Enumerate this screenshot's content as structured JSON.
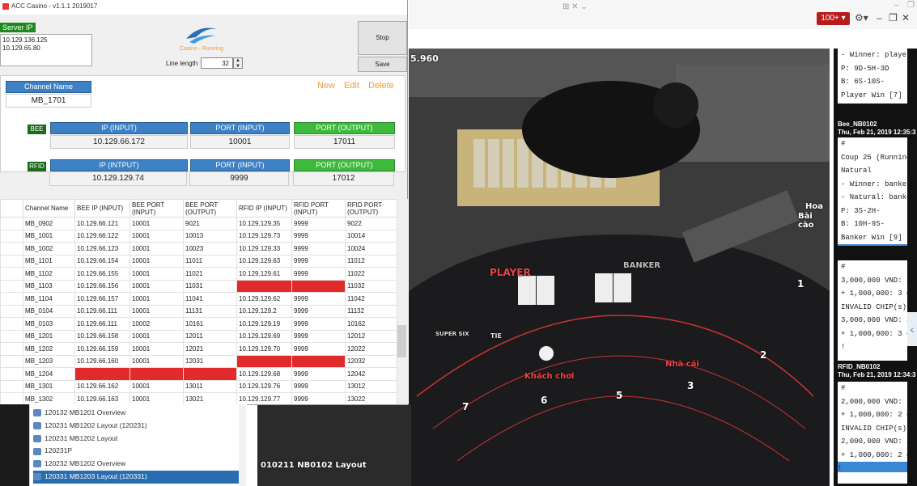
{
  "app": {
    "title": "ACC Casino - v1.1.1 2019017",
    "server_label": "Server IP",
    "server_ips": [
      "10.129.136.125",
      "10.129.65.80"
    ],
    "status": "Casino - Running",
    "line_length_label": "Line length",
    "line_length_value": "32",
    "stop_label": "Stop",
    "save_label": "Save",
    "channel_name_header": "Channel Name",
    "channel_name_value": "MB_1701",
    "new_label": "New",
    "edit_label": "Edit",
    "delete_label": "Delete",
    "bee_tag": "BEE",
    "rfid_tag": "RFID",
    "bee_headers": [
      "IP (INPUT)",
      "PORT (INPUT)",
      "PORT (OUTPUT)"
    ],
    "bee_values": [
      "10.129.66.172",
      "10001",
      "17011"
    ],
    "rfid_headers": [
      "IP (INTPUT)",
      "PORT (INPUT)",
      "PORT (OUTPUT)"
    ],
    "rfid_values": [
      "10.129.129.74",
      "9999",
      "17012"
    ]
  },
  "grid": {
    "columns": [
      "Channel Name",
      "BEE IP (INPUT)",
      "BEE PORT (INPUT)",
      "BEE PORT (OUTPUT)",
      "RFID IP (INPUT)",
      "RFID PORT (INPUT)",
      "RFID PORT (OUTPUT)"
    ],
    "rows": [
      {
        "cells": [
          "MB_0902",
          "10.129.66.121",
          "10001",
          "9021",
          "10.129.129.35",
          "9999",
          "9022"
        ],
        "red": []
      },
      {
        "cells": [
          "MB_1001",
          "10.129.66.122",
          "10001",
          "10013",
          "10.129.129.73",
          "9999",
          "10014"
        ],
        "red": []
      },
      {
        "cells": [
          "MB_1002",
          "10.129.66.123",
          "10001",
          "10023",
          "10.129.129.33",
          "9999",
          "10024"
        ],
        "red": []
      },
      {
        "cells": [
          "MB_1101",
          "10.129.66.154",
          "10001",
          "11011",
          "10.129.129.63",
          "9999",
          "11012"
        ],
        "red": []
      },
      {
        "cells": [
          "MB_1102",
          "10.129.66.155",
          "10001",
          "11021",
          "10.129.129.61",
          "9999",
          "11022"
        ],
        "red": []
      },
      {
        "cells": [
          "MB_1103",
          "10.129.66.156",
          "10001",
          "11031",
          "",
          "",
          "11032"
        ],
        "red": [
          4,
          5
        ]
      },
      {
        "cells": [
          "MB_1104",
          "10.129.66.157",
          "10001",
          "11041",
          "10.129.129.62",
          "9999",
          "11042"
        ],
        "red": []
      },
      {
        "cells": [
          "MB_0104",
          "10.129.66.111",
          "10001",
          "11131",
          "10.129.129.2",
          "9999",
          "11132"
        ],
        "red": []
      },
      {
        "cells": [
          "MB_0103",
          "10.129.66.111",
          "10002",
          "10161",
          "10.129.129.19",
          "9999",
          "10162"
        ],
        "red": []
      },
      {
        "cells": [
          "MB_1201",
          "10.129.66.158",
          "10001",
          "12011",
          "10.129.129.69",
          "9999",
          "12012"
        ],
        "red": []
      },
      {
        "cells": [
          "MB_1202",
          "10.129.66.159",
          "10001",
          "12021",
          "10.129.129.70",
          "9999",
          "12022"
        ],
        "red": []
      },
      {
        "cells": [
          "MB_1203",
          "10.129.66.160",
          "10001",
          "12031",
          "",
          "",
          "12032"
        ],
        "red": [
          4,
          5
        ]
      },
      {
        "cells": [
          "MB_1204",
          "",
          "",
          "",
          "10.129.129.68",
          "9999",
          "12042"
        ],
        "red": [
          1,
          2,
          3
        ]
      },
      {
        "cells": [
          "MB_1301",
          "10.129.66.162",
          "10001",
          "13011",
          "10.129.129.76",
          "9999",
          "13012"
        ],
        "red": []
      },
      {
        "cells": [
          "MB_1302",
          "10.129.66.163",
          "10001",
          "13021",
          "10.129.129.77",
          "9999",
          "13022"
        ],
        "red": []
      }
    ]
  },
  "tree": {
    "items": [
      {
        "label": "120132 MB1201 Overview",
        "selected": false
      },
      {
        "label": "120231 MB1202 Layout (120231)",
        "selected": false
      },
      {
        "label": "120231 MB1202 Layout",
        "selected": false
      },
      {
        "label": "120231P",
        "selected": false
      },
      {
        "label": "120232 MB1202 Overview",
        "selected": false
      },
      {
        "label": "120331 MB1203 Layout (120331)",
        "selected": true
      }
    ]
  },
  "viewer": {
    "alert_badge": "100+ ▾",
    "timestamp_fragment": "5.960",
    "camera_label": "010211 NB0102 Layout",
    "table_words": [
      "PLAYER",
      "BANKER",
      "Khách chơi",
      "Nhà cái",
      "TIE",
      "SUPER SIX",
      "Hoa",
      "Bài cào"
    ],
    "table_numbers": [
      "1",
      "2",
      "3",
      "5",
      "6",
      "7"
    ]
  },
  "log": {
    "entries": [
      {
        "head": "",
        "lines": [
          "- Winner: player",
          "P: 9D-5H-3D",
          "B: 6S-10S-",
          "Player Win [7]",
          "!"
        ]
      },
      {
        "head": "Bee_NB0102\nThu, Feb 21, 2019 12:35:3",
        "lines": [
          "#",
          "Coup 25 (Running",
          "Natural",
          "- Winner: banker",
          "- Natural: banker",
          "P: 3S-2H-",
          "B: 10H-9S-",
          "Banker Win [9]",
          "!"
        ]
      },
      {
        "head": "",
        "lines": [
          "#",
          "3,000,000 VND: 3",
          "+ 1,000,000: 3 d",
          "INVALID CHIP(s)",
          "3,000,000 VND: 3",
          "+ 1,000,000: 3 d",
          "!"
        ]
      },
      {
        "head": "RFID_NB0102\nThu, Feb 21, 2019 12:34:3",
        "lines": [
          "#",
          "2,000,000 VND: 2",
          "+ 1,000,000: 2 d",
          "INVALID CHIP(s)",
          "2,000,000 VND: 2",
          "+ 1,000,000: 2 d",
          "!"
        ]
      }
    ]
  },
  "colors": {
    "accent_blue": "#3d80c4",
    "accent_green": "#3dba3d",
    "error_red": "#e12b2b",
    "status_orange": "#f39a3a"
  },
  "icons": [
    "app-icon",
    "casino-logo",
    "gear-icon",
    "minimize-icon",
    "restore-icon",
    "close-icon",
    "collapse-arrow-icon",
    "tree-node-icon"
  ]
}
